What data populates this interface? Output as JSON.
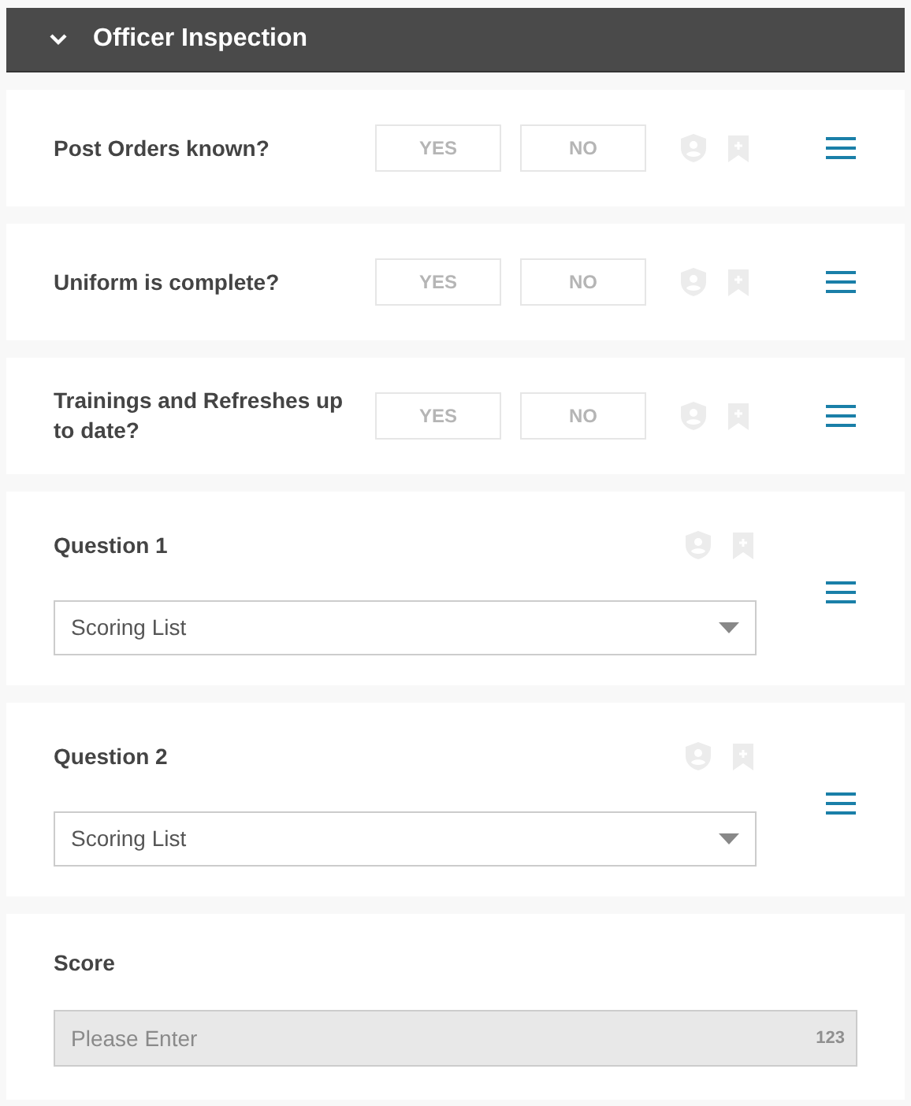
{
  "section": {
    "title": "Officer Inspection",
    "expanded": true
  },
  "questions": [
    {
      "kind": "yes_no",
      "label": "Post Orders known?",
      "yes": "YES",
      "no": "NO"
    },
    {
      "kind": "yes_no",
      "label": "Uniform is complete?",
      "yes": "YES",
      "no": "NO"
    },
    {
      "kind": "yes_no",
      "label": "Trainings and Refreshes up to date?",
      "yes": "YES",
      "no": "NO"
    },
    {
      "kind": "select",
      "label": "Question 1",
      "value": "Scoring List"
    },
    {
      "kind": "select",
      "label": "Question 2",
      "value": "Scoring List"
    }
  ],
  "score": {
    "label": "Score",
    "placeholder": "Please Enter",
    "suffix": "123",
    "disabled": true
  }
}
